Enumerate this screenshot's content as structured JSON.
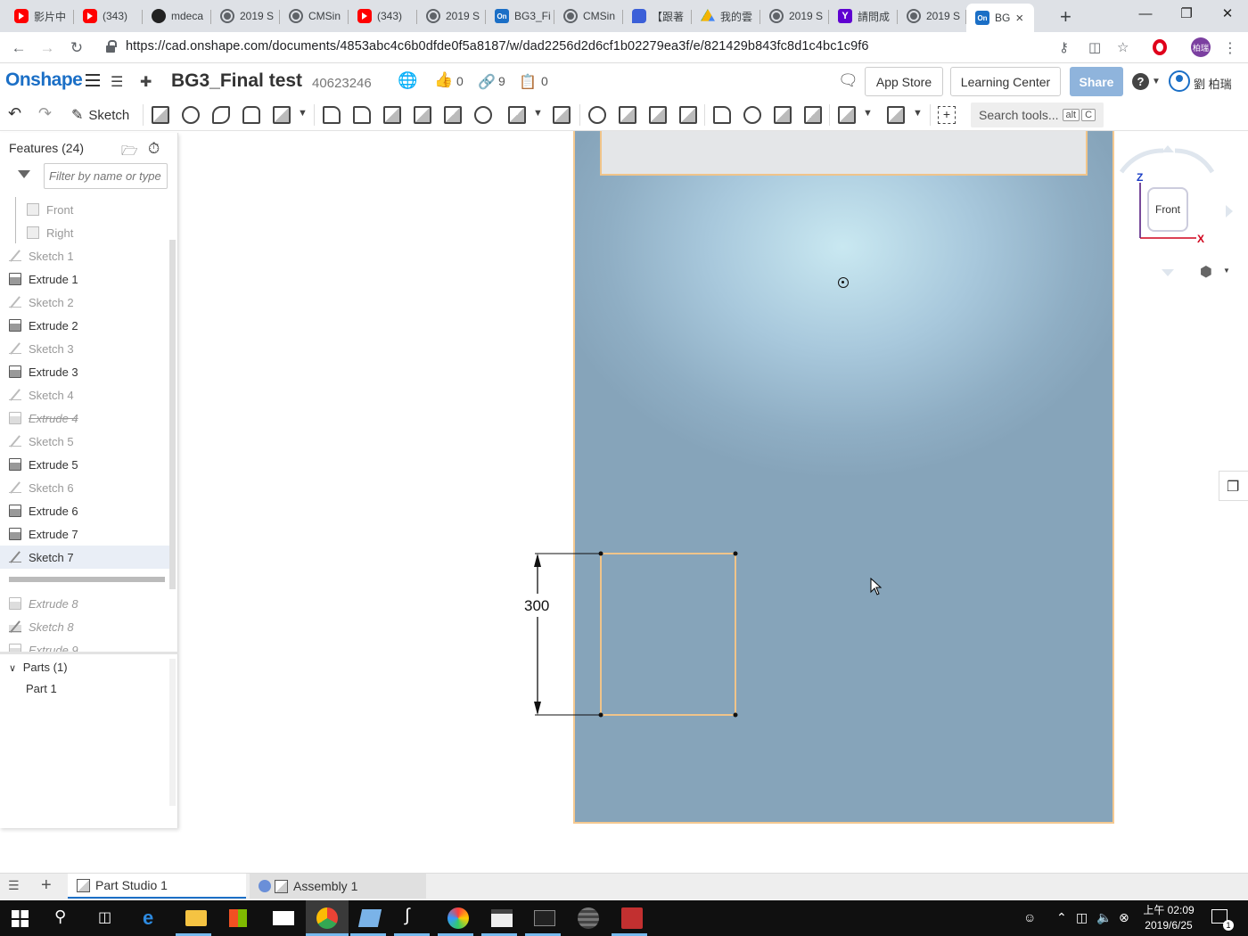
{
  "browser": {
    "tabs": [
      {
        "label": "影片中",
        "favicon": "youtube-icon"
      },
      {
        "label": "(343) ",
        "favicon": "youtube-icon"
      },
      {
        "label": "mdeca",
        "favicon": "github-icon"
      },
      {
        "label": "2019 S",
        "favicon": "globe-icon"
      },
      {
        "label": "CMSin",
        "favicon": "globe-icon"
      },
      {
        "label": "(343) ",
        "favicon": "youtube-icon"
      },
      {
        "label": "2019 S",
        "favicon": "globe-icon"
      },
      {
        "label": "BG3_Fi",
        "favicon": "onshape-icon"
      },
      {
        "label": "CMSin",
        "favicon": "globe-icon"
      },
      {
        "label": "【跟著",
        "favicon": "chat-icon"
      },
      {
        "label": "我的雲",
        "favicon": "drive-icon"
      },
      {
        "label": "2019 S",
        "favicon": "globe-icon"
      },
      {
        "label": "請問成",
        "favicon": "yahoo-icon"
      },
      {
        "label": "2019 S",
        "favicon": "globe-icon"
      },
      {
        "label": "BG",
        "favicon": "onshape-icon"
      }
    ],
    "favicon_onshape_text": "On",
    "favicon_yahoo_text": "Y",
    "url": "https://cad.onshape.com/documents/4853abc4c6b0dfde0f5a8187/w/dad2256d2d6cf1b02279ea3f/e/821429b843fc8d1c4bc1c9f6",
    "profile_initials": "柏瑞"
  },
  "onshape": {
    "logo": "Onshape",
    "document_name": "BG3_Final test",
    "document_number": "40623246",
    "likes": "0",
    "links": "9",
    "copies": "0",
    "app_store": "App Store",
    "learning_center": "Learning Center",
    "share": "Share",
    "user_name": "劉 柏瑞"
  },
  "toolbar": {
    "sketch_label": "Sketch",
    "search_placeholder": "Search tools...",
    "search_key1": "alt",
    "search_key2": "C"
  },
  "features": {
    "title": "Features (24)",
    "filter_placeholder": "Filter by name or type",
    "items": [
      {
        "label": "Front",
        "type": "plane"
      },
      {
        "label": "Right",
        "type": "plane"
      },
      {
        "label": "Sketch 1",
        "type": "sketch"
      },
      {
        "label": "Extrude 1",
        "type": "extrude"
      },
      {
        "label": "Sketch 2",
        "type": "sketch"
      },
      {
        "label": "Extrude 2",
        "type": "extrude"
      },
      {
        "label": "Sketch 3",
        "type": "sketch"
      },
      {
        "label": "Extrude 3",
        "type": "extrude"
      },
      {
        "label": "Sketch 4",
        "type": "sketch"
      },
      {
        "label": "Extrude 4",
        "type": "extrude-suppressed"
      },
      {
        "label": "Sketch 5",
        "type": "sketch"
      },
      {
        "label": "Extrude 5",
        "type": "extrude"
      },
      {
        "label": "Sketch 6",
        "type": "sketch"
      },
      {
        "label": "Extrude 6",
        "type": "extrude"
      },
      {
        "label": "Extrude 7",
        "type": "extrude"
      },
      {
        "label": "Sketch 7",
        "type": "sketch-selected"
      },
      {
        "label": "Extrude 8",
        "type": "rolled-back"
      },
      {
        "label": "Sketch 8",
        "type": "rolled-back"
      },
      {
        "label": "Extrude 9",
        "type": "rolled-back"
      }
    ],
    "parts_header": "Parts (1)",
    "part": "Part 1"
  },
  "viewport": {
    "dimension": "300",
    "view_cube_face": "Front",
    "axis_z": "Z",
    "axis_x": "X",
    "plate_color": "#8fadc3",
    "highlight_color": "#f0c48a"
  },
  "bottom_tabs": {
    "part_studio": "Part Studio 1",
    "assembly": "Assembly 1"
  },
  "taskbar": {
    "time": "上午 02:09",
    "date": "2019/6/25",
    "notification_count": "1"
  }
}
